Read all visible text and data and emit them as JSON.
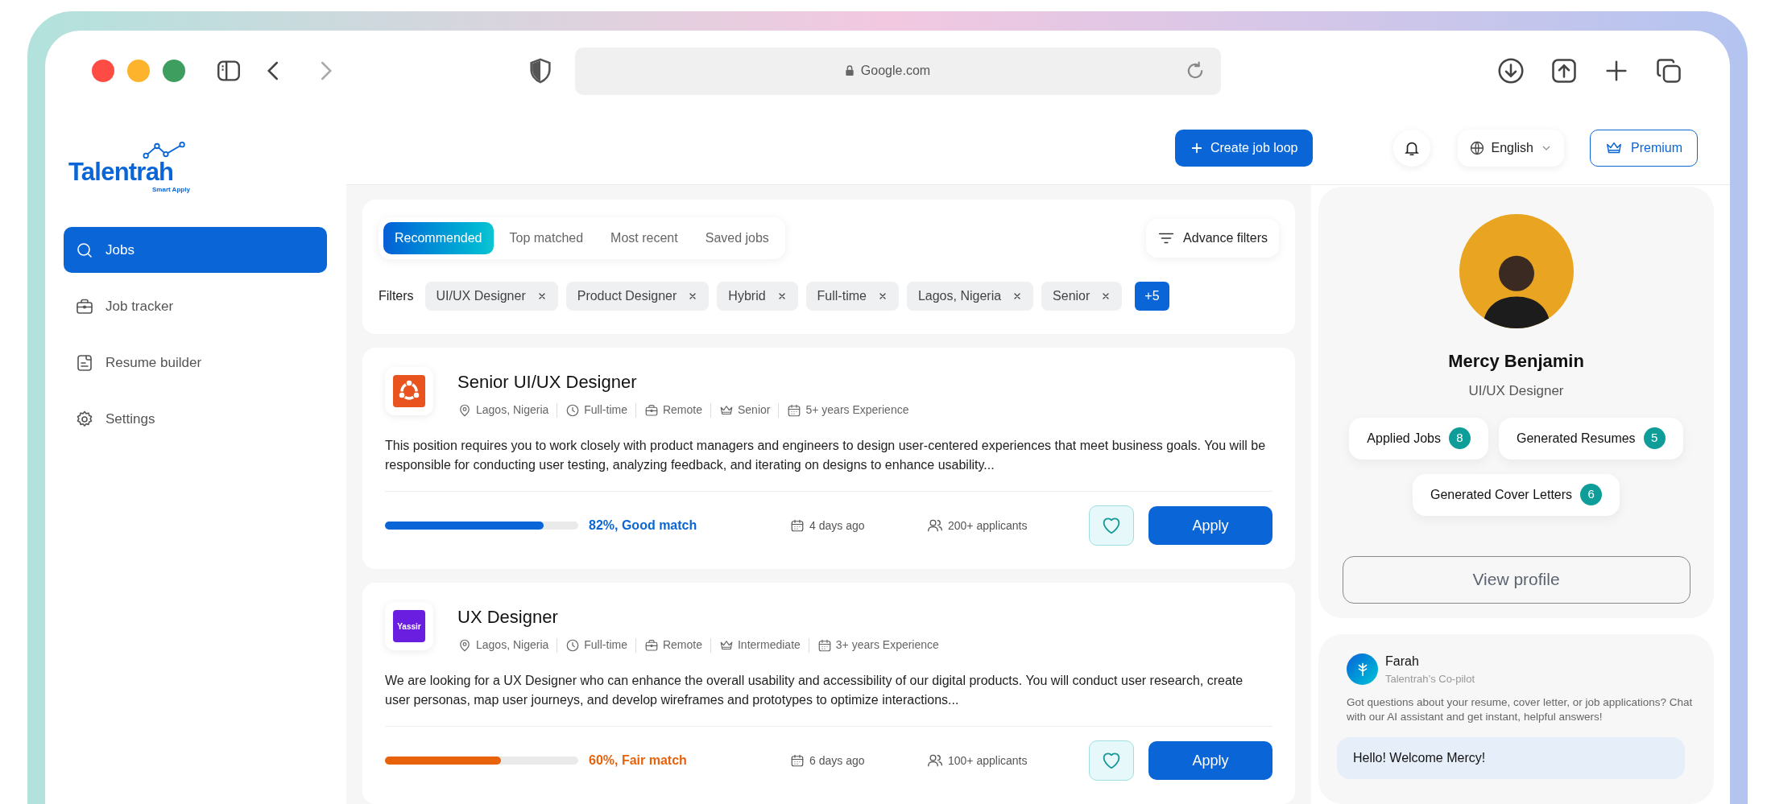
{
  "browser": {
    "url": "Google.com"
  },
  "sidebar": {
    "logo": {
      "name": "Talentrah",
      "tagline": "Smart Apply"
    },
    "items": [
      {
        "label": "Jobs",
        "kind": "search",
        "selected": true
      },
      {
        "label": "Job tracker",
        "kind": "briefcase",
        "selected": false
      },
      {
        "label": "Resume builder",
        "kind": "document",
        "selected": false
      },
      {
        "label": "Settings",
        "kind": "settings",
        "selected": false
      }
    ]
  },
  "header": {
    "create_button": "Create job loop",
    "language": "English",
    "premium": "Premium"
  },
  "tabs": [
    {
      "label": "Recommended",
      "selected": true
    },
    {
      "label": "Top matched",
      "selected": false
    },
    {
      "label": "Most recent",
      "selected": false
    },
    {
      "label": "Saved jobs",
      "selected": false
    }
  ],
  "advance_filters": "Advance filters",
  "filters": {
    "label": "Filters",
    "chips": [
      "UI/UX Designer",
      "Product Designer",
      "Hybrid",
      "Full-time",
      "Lagos, Nigeria",
      "Senior"
    ],
    "more": "+5"
  },
  "jobs": [
    {
      "title": "Senior UI/UX Designer",
      "logo": {
        "kind": "ring",
        "color": "#e9531f"
      },
      "meta": [
        {
          "kind": "location",
          "text": "Lagos, Nigeria"
        },
        {
          "kind": "clock",
          "text": "Full-time"
        },
        {
          "kind": "briefcase",
          "text": "Remote"
        },
        {
          "kind": "crown",
          "text": "Senior"
        },
        {
          "kind": "calendar",
          "text": "5+ years Experience"
        }
      ],
      "description": "This position requires you to work closely with product managers and engineers to design user-centered experiences that meet business goals. You will be responsible for conducting user testing, analyzing feedback, and iterating on designs to enhance usability...",
      "match": {
        "level": 0.82,
        "text": "82%, Good match",
        "color": "#0a66d6"
      },
      "posted": "4 days ago",
      "applicants": "200+ applicants",
      "saved": false,
      "apply": "Apply"
    },
    {
      "title": "UX Designer",
      "logo": {
        "kind": "wordmark",
        "color": "#6a1ee0",
        "text": "Yassir"
      },
      "meta": [
        {
          "kind": "location",
          "text": "Lagos, Nigeria"
        },
        {
          "kind": "clock",
          "text": "Full-time"
        },
        {
          "kind": "briefcase",
          "text": "Remote"
        },
        {
          "kind": "crown",
          "text": "Intermediate"
        },
        {
          "kind": "calendar",
          "text": "3+ years Experience"
        }
      ],
      "description": "We are looking for a UX Designer who can enhance the overall usability and accessibility of our digital products. You will conduct user research, create user personas, map user journeys, and develop wireframes and prototypes to optimize interactions...",
      "match": {
        "level": 0.6,
        "text": "60%, Fair match",
        "color": "#e8620c"
      },
      "posted": "6 days ago",
      "applicants": "100+ applicants",
      "saved": false,
      "apply": "Apply"
    }
  ],
  "profile": {
    "name": "Mercy Benjamin",
    "role": "UI/UX Designer",
    "stats": [
      {
        "label": "Applied Jobs",
        "count": "8"
      },
      {
        "label": "Generated Resumes",
        "count": "5"
      },
      {
        "label": "Generated Cover Letters",
        "count": "6"
      }
    ],
    "button": "View profile"
  },
  "copilot": {
    "name": "Farah",
    "subtitle": "Talentrah’s Co-pilot",
    "description": "Got questions about your resume, cover letter, or job applications? Chat with our AI assistant and get instant, helpful answers!",
    "message": "Hello! Welcome Mercy!"
  }
}
